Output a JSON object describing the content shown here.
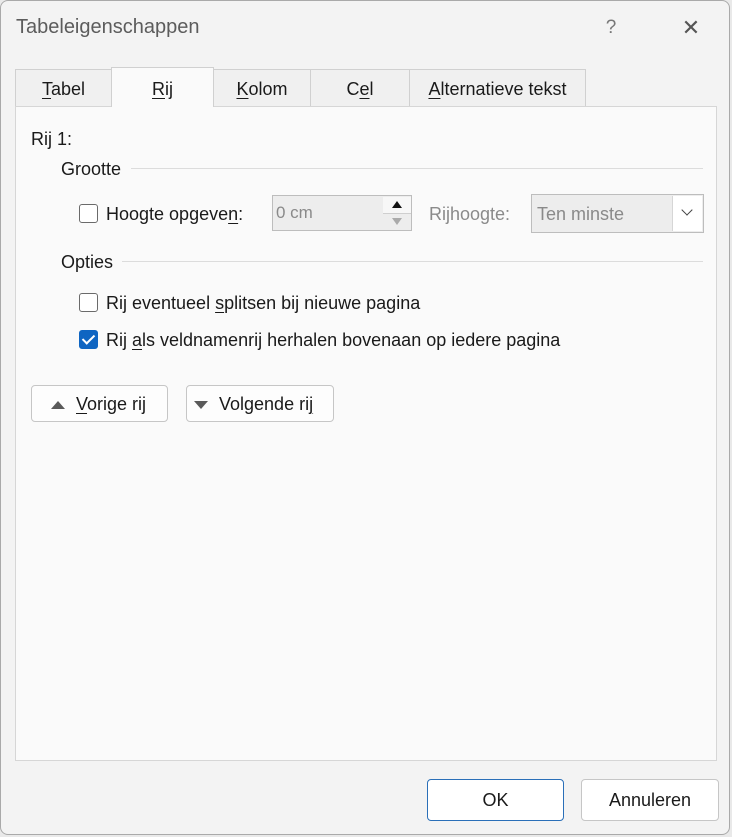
{
  "window": {
    "title": "Tabeleigenschappen",
    "help": "?",
    "close": "✕"
  },
  "tabs": [
    {
      "pre": "",
      "u": "T",
      "post": "abel"
    },
    {
      "pre": "",
      "u": "R",
      "post": "ij"
    },
    {
      "pre": "",
      "u": "K",
      "post": "olom"
    },
    {
      "pre": "C",
      "u": "e",
      "post": "l"
    },
    {
      "pre": "",
      "u": "A",
      "post": "lternatieve tekst"
    }
  ],
  "row_header": "Rij 1:",
  "size_group": {
    "title": "Grootte",
    "height_checkbox": {
      "pre": "Hoogte opgeve",
      "u": "n",
      "post": ":",
      "checked": false
    },
    "height_value": "0 cm",
    "row_height_label": "Rijhoogte:",
    "row_height_select": "Ten minste"
  },
  "options_group": {
    "title": "Opties",
    "split": {
      "pre": "Rij eventueel ",
      "u": "s",
      "post": "plitsen bij nieuwe pagina",
      "checked": false
    },
    "repeat": {
      "pre": "Rij ",
      "u": "a",
      "post": "ls veldnamenrij herhalen bovenaan op iedere pagina",
      "checked": true
    }
  },
  "nav_buttons": {
    "previous": {
      "pre": "",
      "u": "V",
      "post": "orige rij"
    },
    "next": {
      "pre": "Volgende ri",
      "u": "j",
      "post": ""
    }
  },
  "footer": {
    "ok": "OK",
    "cancel": "Annuleren"
  },
  "colors": {
    "accent": "#0f65c2",
    "ok_border": "#2a6fb8"
  }
}
